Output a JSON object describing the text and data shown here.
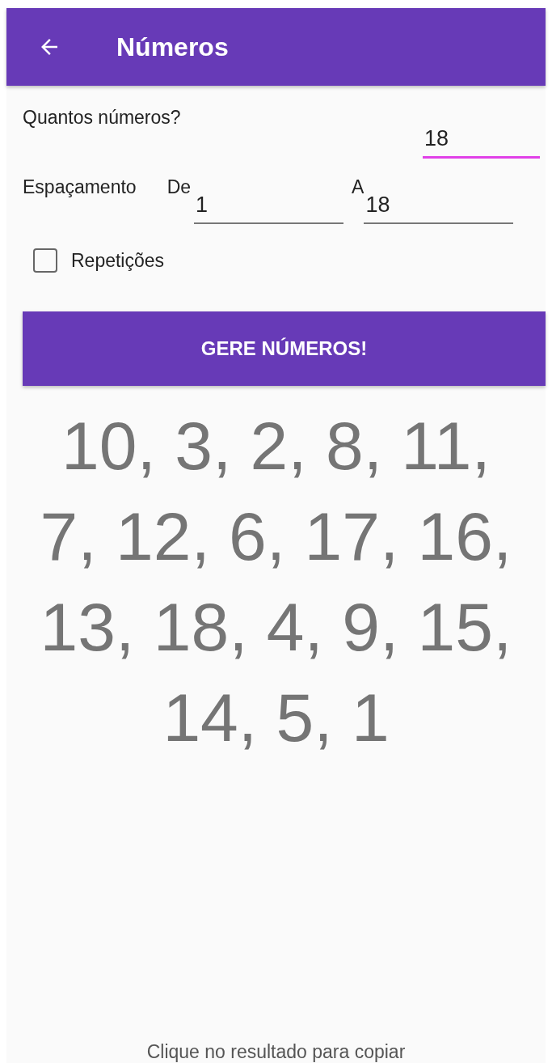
{
  "app_bar": {
    "title": "Números"
  },
  "quantity": {
    "label": "Quantos números?",
    "value": "18",
    "focused": true
  },
  "range": {
    "label": "Espaçamento",
    "from_label": "De",
    "from_value": "1",
    "to_label": "A",
    "to_value": "18"
  },
  "repetitions": {
    "label": "Repetições",
    "checked": false
  },
  "generate_button": "GERE NÚMEROS!",
  "result_lines": [
    "10, 3, 2, 8, 11,",
    "7, 12, 6, 17, 16,",
    "13, 18, 4, 9, 15,",
    "14, 5, 1"
  ],
  "hint": "Clique no resultado para copiar"
}
